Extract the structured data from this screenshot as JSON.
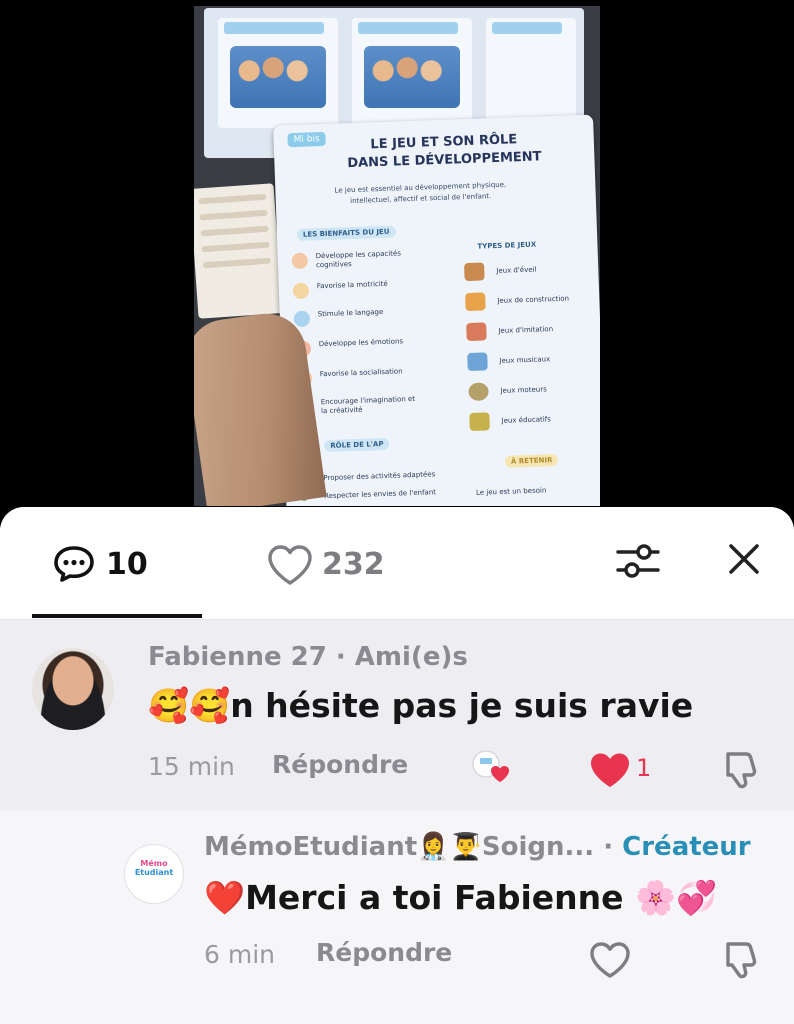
{
  "video": {
    "card_tag": "Mi bis",
    "card_title_line1": "LE JEU ET SON RÔLE",
    "card_title_line2": "DANS LE DÉVELOPPEMENT",
    "card_intro": "Le jeu est essentiel au développement physique, intellectuel, affectif et social de l'enfant.",
    "benefits_heading": "LES BIENFAITS DU JEU",
    "benefits": [
      "Développe les capacités cognitives",
      "Favorise la motricité",
      "Stimule le langage",
      "Développe les émotions",
      "Favorise la socialisation",
      "Encourage l'imagination et la créativité"
    ],
    "types_heading": "TYPES DE JEUX",
    "types": [
      "Jeux d'éveil",
      "Jeux de construction",
      "Jeux d'imitation",
      "Jeux musicaux",
      "Jeux moteurs",
      "Jeux éducatifs"
    ],
    "role_heading": "RÔLE DE L'AP",
    "role_items": [
      "Proposer des activités adaptées",
      "Respecter les envies de l'enfant"
    ],
    "retenir_heading": "À RETENIR",
    "retenir_text": "Le jeu est un besoin"
  },
  "tabs": {
    "comments_count": "10",
    "likes_count": "232"
  },
  "comments": [
    {
      "username": "Fabienne 27",
      "relation": " · Ami(e)s",
      "emoji": "🥰🥰",
      "text": "n hésite pas je suis ravie",
      "time": "15 min",
      "reply_label": "Répondre",
      "like_count": "1",
      "colors": {
        "like": "#e8344e"
      }
    },
    {
      "username": "MémoEtudiant👩‍⚕️👨‍🎓Soign...",
      "relation": " · ",
      "creator_label": "Créateur",
      "text": "❤️Merci a toi Fabienne 🌸💞",
      "time": "6 min",
      "reply_label": "Répondre",
      "avatar_logo_line1": "Mémo",
      "avatar_logo_line2": "Etudiant"
    }
  ],
  "colors": {
    "creator": "#2a8fb7",
    "sheet_bg": "#f4f4f6"
  }
}
